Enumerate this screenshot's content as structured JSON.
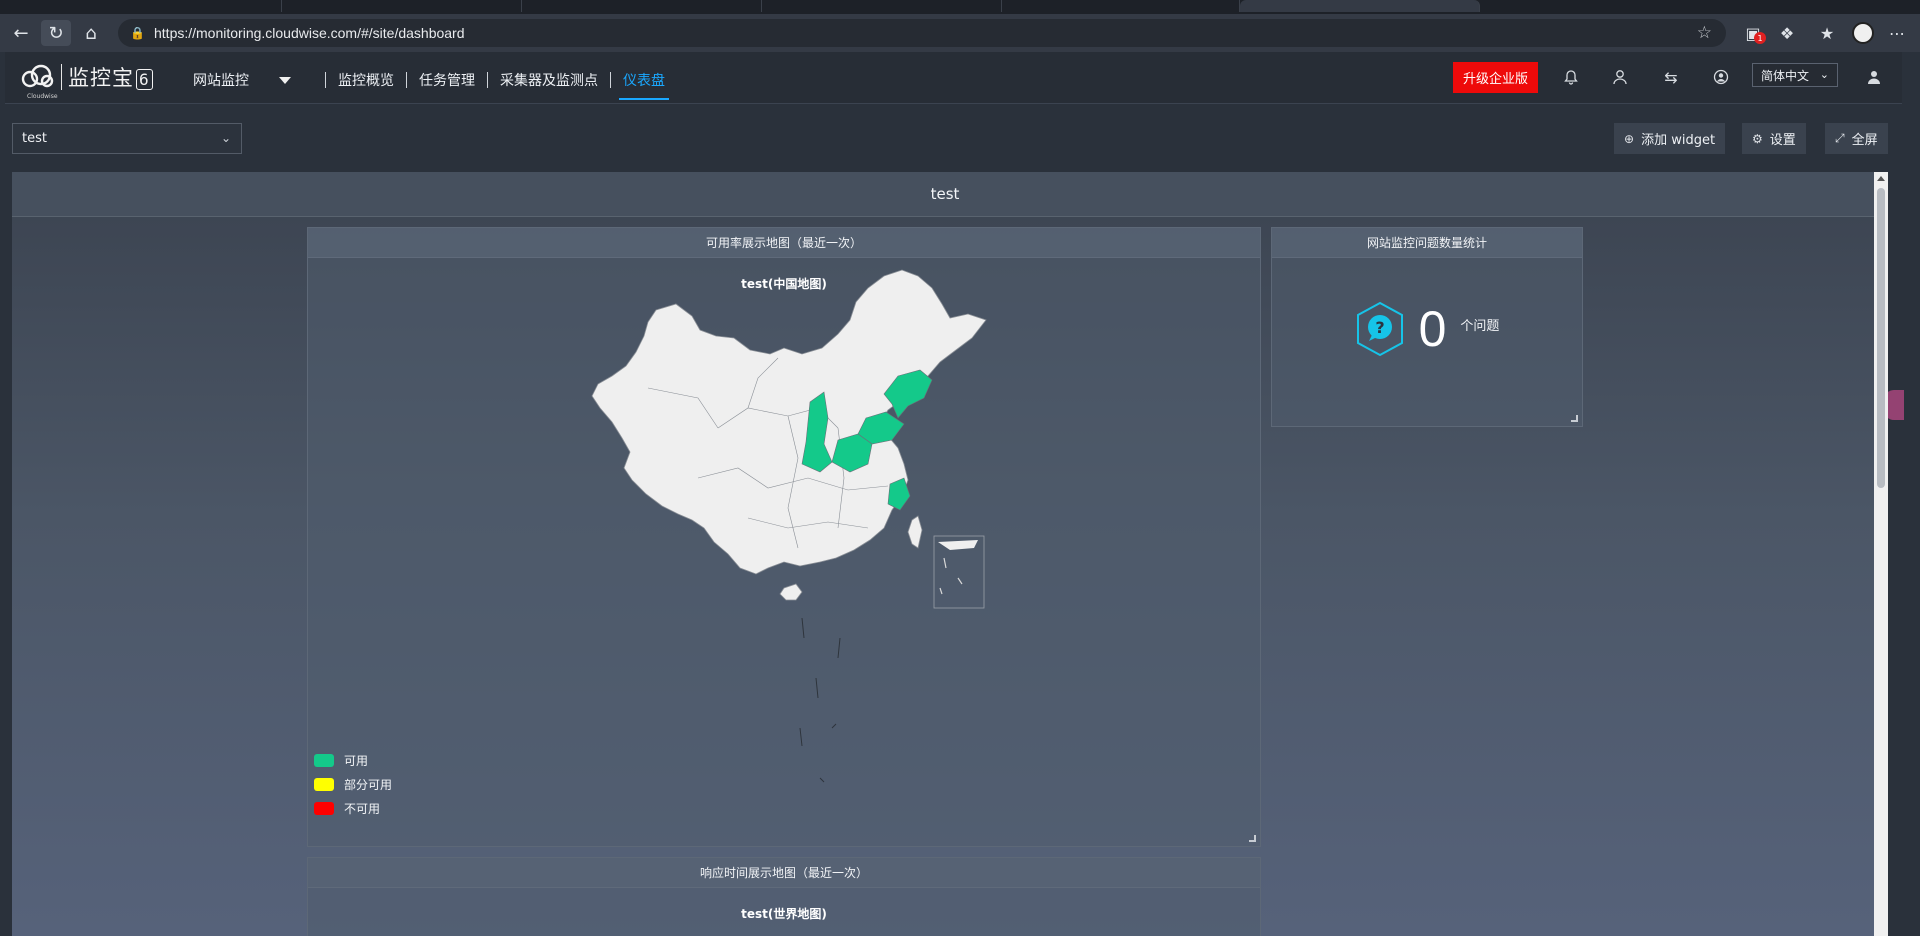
{
  "browser": {
    "url": "https://monitoring.cloudwise.com/#/site/dashboard",
    "extension_badge": "1"
  },
  "header": {
    "brand": "监控宝",
    "brand_suffix": "6",
    "logo_sub": "Cloudwise",
    "product_menu": "网站监控",
    "nav": [
      "监控概览",
      "任务管理",
      "采集器及监测点",
      "仪表盘"
    ],
    "upgrade_label": "升级企业版",
    "language": "简体中文"
  },
  "toolbar": {
    "selected_dashboard": "test",
    "add_widget": "添加 widget",
    "settings": "设置",
    "fullscreen": "全屏"
  },
  "dashboard": {
    "title": "test",
    "map_widget": {
      "title": "可用率展示地图（最近一次）",
      "map_title": "test(中国地图)",
      "legend": [
        {
          "label": "可用",
          "color": "#14c98a"
        },
        {
          "label": "部分可用",
          "color": "#ffff00"
        },
        {
          "label": "不可用",
          "color": "#ff0000"
        }
      ]
    },
    "issue_widget": {
      "title": "网站监控问题数量统计",
      "count": "0",
      "unit": "个问题"
    },
    "response_widget": {
      "title": "响应时间展示地图（最近一次）",
      "map_title": "test(世界地图)"
    }
  },
  "colors": {
    "accent": "#1aa8ff",
    "upgrade": "#ee0a0a",
    "available": "#14c98a",
    "map_fill": "#efefef"
  }
}
